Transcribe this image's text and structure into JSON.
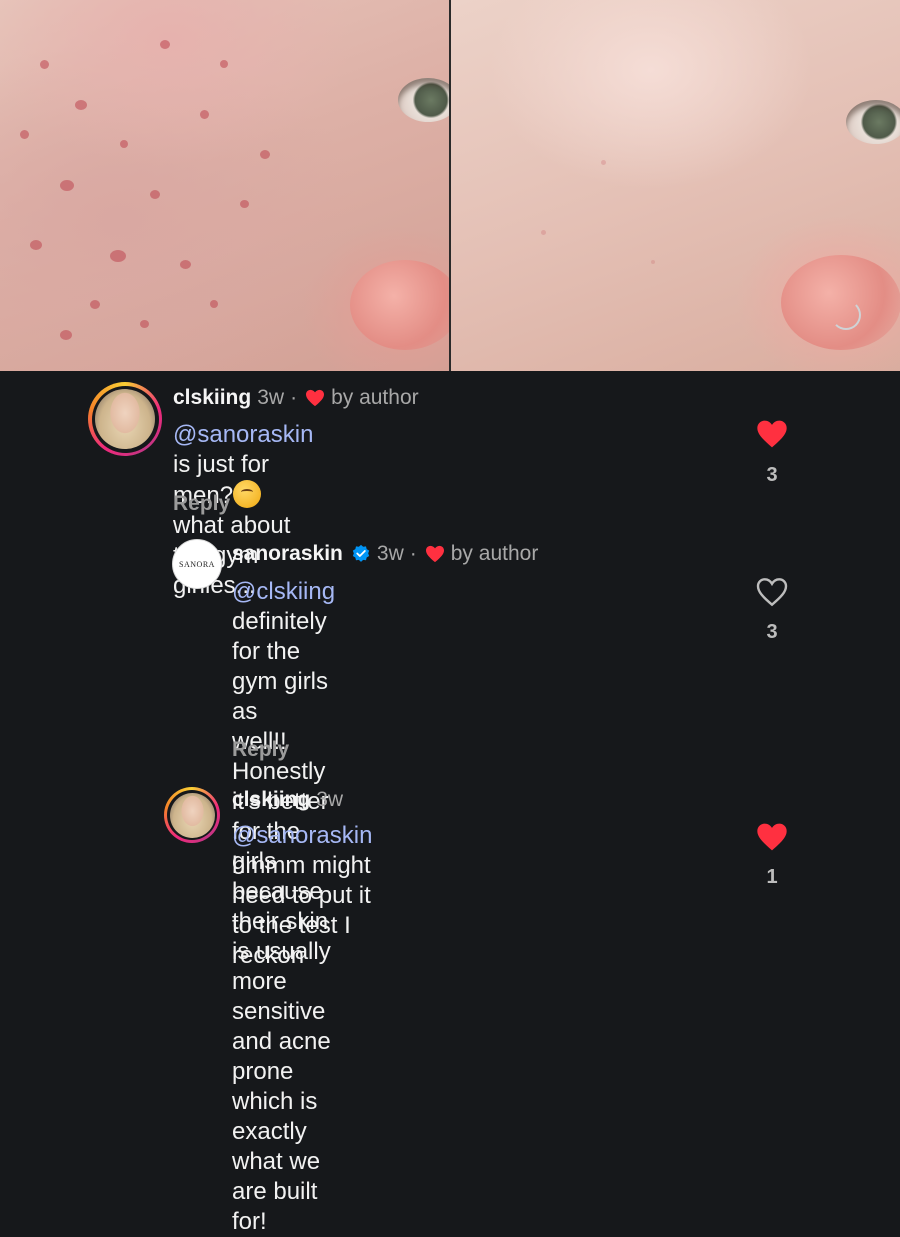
{
  "comments": [
    {
      "username": "clskiing",
      "time": "3w",
      "author_like": "by author",
      "mention": "@sanoraskin",
      "text_a": " is just for men?",
      "text_b": "what about the gym girlies...",
      "reply_label": "Reply",
      "likes": "3",
      "liked": true
    },
    {
      "username": "sanoraskin",
      "verified": true,
      "avatar_text": "SANORA",
      "time": "3w",
      "author_like": "by author",
      "mention": "@clskiing",
      "lines": [
        " definitely for the gym girls as",
        "well!! Honestly it's better for the girls",
        "because their skin is usually more",
        "sensitive and acne prone which is",
        "exactly what we are built for!"
      ],
      "reply_label": "Reply",
      "likes": "3",
      "liked": false
    },
    {
      "username": "clskiing",
      "time": "3w",
      "mention": "@sanoraskin",
      "text_a": " hmmm might need to put it",
      "text_b": "to the test I reckon",
      "likes": "1",
      "liked": true
    }
  ],
  "icons": {
    "like_filled": "heart-filled-icon",
    "like_outline": "heart-outline-icon",
    "verified": "verified-badge-icon",
    "emoji": "thinking-face-emoji"
  },
  "colors": {
    "background": "#16181b",
    "heart": "#ff3040",
    "mention": "#a6b8f5",
    "verified": "#0095f6"
  }
}
